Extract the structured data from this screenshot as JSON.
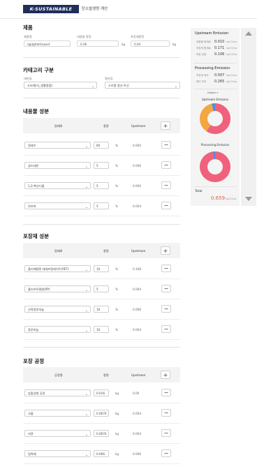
{
  "brand": {
    "logo": "K-SUSTAINABLE",
    "subtitle": "탄소발생량 계산"
  },
  "product": {
    "title": "제품",
    "fields": [
      {
        "label": "제품명",
        "value": "dgdgfdefsaasef",
        "unit": ""
      },
      {
        "label": "내용물 중량",
        "value": "0.06",
        "unit": "kg"
      },
      {
        "label": "포장재중량",
        "value": "0.04",
        "unit": "kg"
      }
    ]
  },
  "category": {
    "title": "카테고리 구분",
    "fields": [
      {
        "label": "대분류",
        "value": "소비재(식_생활용품)"
      },
      {
        "label": "중분류",
        "value": "소모품 용산-토산"
      }
    ]
  },
  "content": {
    "title": "내용물 성분",
    "headers": {
      "component": "원재료",
      "weight": "중량",
      "upstream": "Upstream"
    },
    "rows": [
      {
        "name": "정제수",
        "weight": "85",
        "unit": "%",
        "upstream": "0.000"
      },
      {
        "name": "글리세린",
        "weight": "5",
        "unit": "%",
        "upstream": "0.006"
      },
      {
        "name": "1,2-헥산디올",
        "weight": "5",
        "unit": "%",
        "upstream": "0.000"
      },
      {
        "name": "카보머",
        "weight": "5",
        "unit": "%",
        "upstream": "0.004"
      }
    ]
  },
  "packaging": {
    "title": "포장재 성분",
    "headers": {
      "component": "원재료",
      "weight": "중량",
      "upstream": "Upstream"
    },
    "rows": [
      {
        "name": "폴리에틸렌 테레프탈레이트(PET)",
        "weight": "10",
        "unit": "%",
        "upstream": "0.168"
      },
      {
        "name": "폴리프로필렌(PP)",
        "weight": "5",
        "unit": "%",
        "upstream": "0.004"
      },
      {
        "name": "산화알루미늄",
        "weight": "10",
        "unit": "%",
        "upstream": "0.006"
      },
      {
        "name": "알루미늄",
        "weight": "10",
        "unit": "%",
        "upstream": "0.004"
      }
    ]
  },
  "process": {
    "title": "포장 공정",
    "headers": {
      "component": "공정명",
      "weight": "중량",
      "upstream": "Upstream"
    },
    "rows": [
      {
        "name": "압출성형 공정",
        "weight": "0.016",
        "unit": "kg",
        "upstream": "0.00"
      },
      {
        "name": "사출",
        "weight": "0.0074",
        "unit": "kg",
        "upstream": "0.004"
      },
      {
        "name": "지관",
        "weight": "0.0074",
        "unit": "kg",
        "upstream": "0.004"
      },
      {
        "name": "접착제",
        "weight": "0.006",
        "unit": "kg",
        "upstream": "0.006"
      }
    ]
  },
  "summary": {
    "upstream_title": "Upstream Emission",
    "upstream_rows": [
      {
        "label": "내용물 원재료",
        "value": "0.010",
        "unit": "kgCO2eq"
      },
      {
        "label": "포장재 원재료",
        "value": "0.171",
        "unit": "kgCO2eq"
      },
      {
        "label": "포장 공정",
        "value": "0.106",
        "unit": "kgCO2eq"
      }
    ],
    "processing_title": "Processing Emission",
    "processing_rows": [
      {
        "label": "포장재 제조",
        "value": "0.007",
        "unit": "kgCO2eq"
      },
      {
        "label": "폐기 처리",
        "value": "0.265",
        "unit": "kgCO2eq"
      }
    ],
    "toggle_label": "Details ▾",
    "donut1_label": "Upstream Emission",
    "donut1_values": [
      0.171,
      0.106,
      0.01
    ],
    "donut2_label": "Processing Emission",
    "donut2_values": [
      0.265,
      0.007
    ],
    "colors": {
      "pink": "#f0617d",
      "orange": "#f3a641",
      "blue": "#4a90d9",
      "total": "#e0604f"
    },
    "total_label": "Total",
    "total_value": "0.659",
    "total_unit": "kgCO2eq"
  }
}
